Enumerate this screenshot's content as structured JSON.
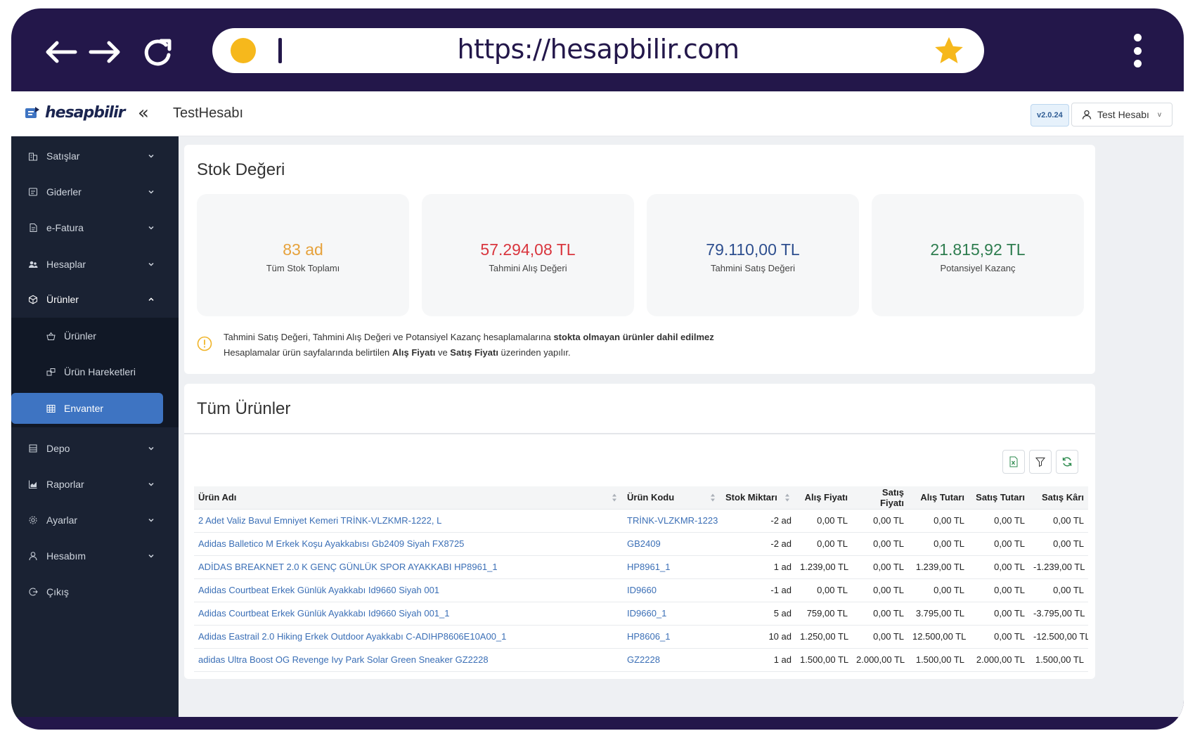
{
  "browser": {
    "url": "https://hesapbilir.com"
  },
  "header": {
    "logo": "hesapbilir",
    "account_title": "TestHesabı",
    "version": "v2.0.24",
    "user_label": "Test Hesabı"
  },
  "sidebar": {
    "items": [
      {
        "label": "Satışlar",
        "icon": "building-icon"
      },
      {
        "label": "Giderler",
        "icon": "receipt-icon"
      },
      {
        "label": "e-Fatura",
        "icon": "invoice-icon"
      },
      {
        "label": "Hesaplar",
        "icon": "users-icon"
      },
      {
        "label": "Ürünler",
        "icon": "box-icon"
      },
      {
        "label": "Depo",
        "icon": "warehouse-icon"
      },
      {
        "label": "Raporlar",
        "icon": "chart-icon"
      },
      {
        "label": "Ayarlar",
        "icon": "gear-icon"
      },
      {
        "label": "Hesabım",
        "icon": "user-icon"
      },
      {
        "label": "Çıkış",
        "icon": "logout-icon"
      }
    ],
    "sub_items": [
      {
        "label": "Ürünler",
        "icon": "basket-icon"
      },
      {
        "label": "Ürün Hareketleri",
        "icon": "move-icon"
      },
      {
        "label": "Envanter",
        "icon": "grid-icon"
      }
    ]
  },
  "stock": {
    "title": "Stok Değeri",
    "stats": [
      {
        "value": "83 ad",
        "label": "Tüm Stok Toplamı",
        "color": "#e6a23c"
      },
      {
        "value": "57.294,08 TL",
        "label": "Tahmini Alış Değeri",
        "color": "#d9363e"
      },
      {
        "value": "79.110,00 TL",
        "label": "Tahmini Satış Değeri",
        "color": "#2e4f8f"
      },
      {
        "value": "21.815,92 TL",
        "label": "Potansiyel Kazanç",
        "color": "#2e7d4f"
      }
    ],
    "info": {
      "line1_a": "Tahmini Satış Değeri, Tahmini Alış Değeri ve Potansiyel Kazanç hesaplamalarına ",
      "line1_b": "stokta olmayan ürünler dahil edilmez",
      "line2_a": "Hesaplamalar ürün sayfalarında belirtilen ",
      "line2_b": "Alış Fiyatı",
      "line2_c": " ve ",
      "line2_d": "Satış Fiyatı",
      "line2_e": " üzerinden yapılır."
    }
  },
  "products": {
    "title": "Tüm Ürünler",
    "columns": [
      "Ürün Adı",
      "Ürün Kodu",
      "Stok Miktarı",
      "Alış Fiyatı",
      "Satış Fiyatı",
      "Alış Tutarı",
      "Satış Tutarı",
      "Satış Kârı"
    ],
    "rows": [
      [
        "2 Adet Valiz Bavul Emniyet Kemeri TRİNK-VLZKMR-1222, L",
        "TRİNK-VLZKMR-1223",
        "-2 ad",
        "0,00 TL",
        "0,00 TL",
        "0,00 TL",
        "0,00 TL",
        "0,00 TL"
      ],
      [
        "Adidas Balletico M Erkek Koşu Ayakkabısı Gb2409 Siyah FX8725",
        "GB2409",
        "-2 ad",
        "0,00 TL",
        "0,00 TL",
        "0,00 TL",
        "0,00 TL",
        "0,00 TL"
      ],
      [
        "ADİDAS BREAKNET 2.0 K GENÇ GÜNLÜK SPOR AYAKKABI HP8961_1",
        "HP8961_1",
        "1 ad",
        "1.239,00 TL",
        "0,00 TL",
        "1.239,00 TL",
        "0,00 TL",
        "-1.239,00 TL"
      ],
      [
        "Adidas Courtbeat Erkek Günlük Ayakkabı Id9660 Siyah 001",
        "ID9660",
        "-1 ad",
        "0,00 TL",
        "0,00 TL",
        "0,00 TL",
        "0,00 TL",
        "0,00 TL"
      ],
      [
        "Adidas Courtbeat Erkek Günlük Ayakkabı Id9660 Siyah 001_1",
        "ID9660_1",
        "5 ad",
        "759,00 TL",
        "0,00 TL",
        "3.795,00 TL",
        "0,00 TL",
        "-3.795,00 TL"
      ],
      [
        "Adidas Eastrail 2.0 Hiking Erkek Outdoor Ayakkabı C-ADIHP8606E10A00_1",
        "HP8606_1",
        "10 ad",
        "1.250,00 TL",
        "0,00 TL",
        "12.500,00 TL",
        "0,00 TL",
        "-12.500,00 TL"
      ],
      [
        "adidas Ultra Boost OG Revenge Ivy Park Solar Green Sneaker GZ2228",
        "GZ2228",
        "1 ad",
        "1.500,00 TL",
        "2.000,00 TL",
        "1.500,00 TL",
        "2.000,00 TL",
        "1.500,00 TL"
      ]
    ]
  }
}
